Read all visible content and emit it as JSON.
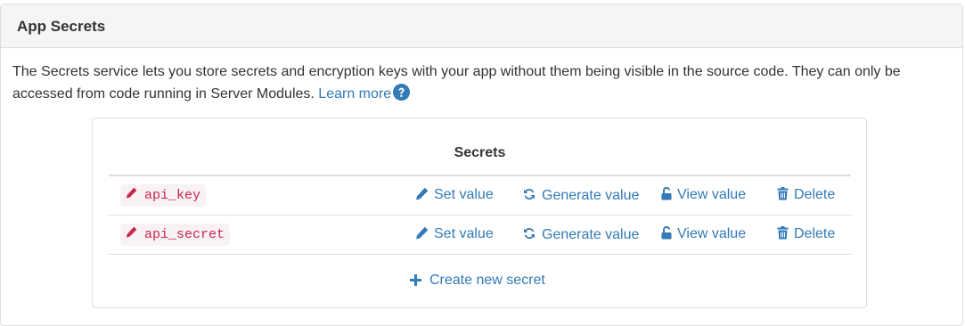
{
  "panel": {
    "title": "App Secrets",
    "description": "The Secrets service lets you store secrets and encryption keys with your app without them being visible in the source code. They can only be accessed from code running in Server Modules.",
    "learn_more_label": "Learn more"
  },
  "secrets": {
    "header": "Secrets",
    "rows": [
      {
        "name": "api_key"
      },
      {
        "name": "api_secret"
      }
    ],
    "actions": {
      "set_value": "Set value",
      "generate_value": "Generate value",
      "view_value": "View value",
      "delete": "Delete"
    },
    "create_label": "Create new secret"
  },
  "colors": {
    "link": "#337ab7",
    "code_text": "#c7254e",
    "code_bg": "#f9f2f4",
    "heading_bg": "#f5f5f5",
    "border": "#dddddd"
  },
  "icons": [
    "help-circle-icon",
    "pencil-icon",
    "refresh-icon",
    "unlock-icon",
    "trash-icon",
    "plus-icon"
  ]
}
